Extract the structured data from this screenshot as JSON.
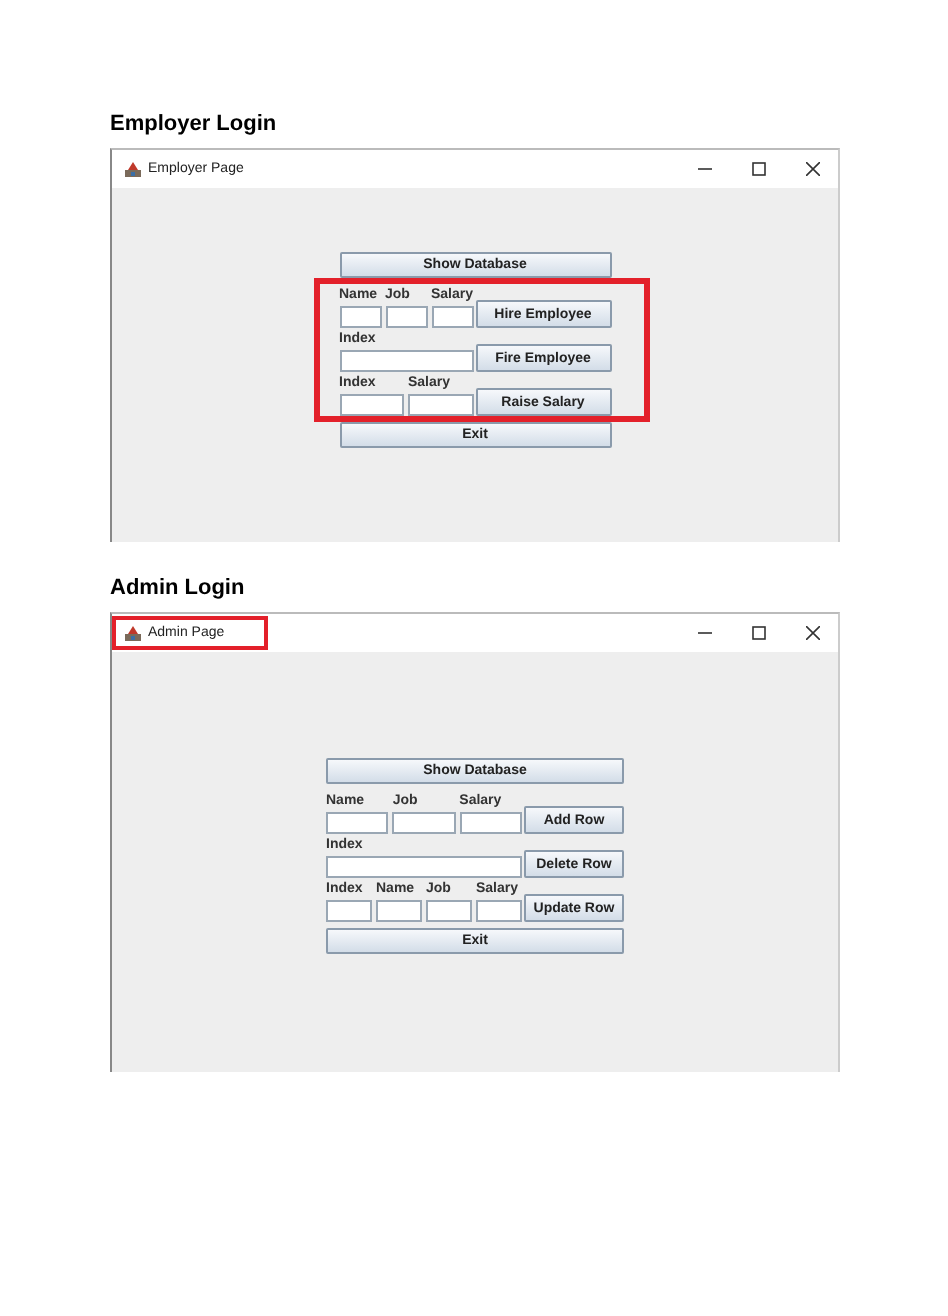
{
  "sections": [
    {
      "heading": "Employer Login",
      "window": {
        "title": "Employer Page",
        "title_highlighted": false,
        "form_highlighted": true,
        "show_button": "Show Database",
        "rows": [
          {
            "fields": [
              {
                "label": "Name"
              },
              {
                "label": "Job"
              },
              {
                "label": "Salary"
              }
            ],
            "button": "Hire Employee"
          },
          {
            "fields": [
              {
                "label": "Index"
              }
            ],
            "button": "Fire Employee"
          },
          {
            "fields": [
              {
                "label": "Index"
              },
              {
                "label": "Salary"
              }
            ],
            "button": "Raise Salary"
          }
        ],
        "exit_button": "Exit"
      }
    },
    {
      "heading": "Admin Login",
      "window": {
        "title": "Admin Page",
        "title_highlighted": true,
        "form_highlighted": false,
        "show_button": "Show Database",
        "rows": [
          {
            "fields": [
              {
                "label": "Name"
              },
              {
                "label": "Job"
              },
              {
                "label": "Salary"
              }
            ],
            "button": "Add Row"
          },
          {
            "fields": [
              {
                "label": "Index"
              }
            ],
            "button": "Delete Row"
          },
          {
            "fields": [
              {
                "label": "Index"
              },
              {
                "label": "Name"
              },
              {
                "label": "Job"
              },
              {
                "label": "Salary"
              }
            ],
            "button": "Update Row"
          }
        ],
        "exit_button": "Exit"
      }
    }
  ]
}
